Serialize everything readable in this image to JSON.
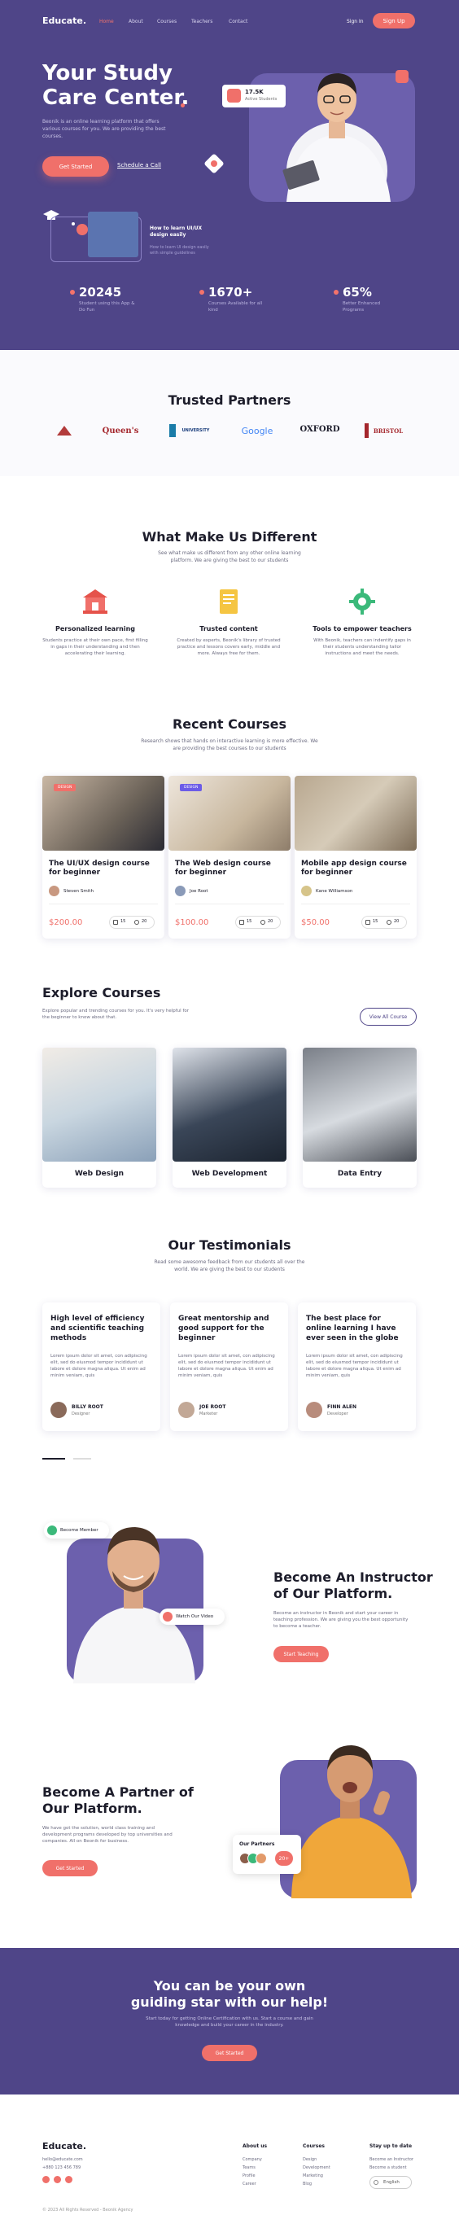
{
  "nav": {
    "logo": "Educate.",
    "links": [
      "Home",
      "About",
      "Courses",
      "Teachers",
      "Contact"
    ],
    "signin": "Sign In",
    "signup": "Sign Up"
  },
  "hero": {
    "title_line1": "Your Study",
    "title_line2": "Care Center.",
    "desc": "Beonik is an online learning platform that offers various courses for you. We are providing the best courses.",
    "cta_primary": "Get Started",
    "cta_secondary": "Schedule a Call",
    "badge_count": "17.5K",
    "badge_label": "Active Students",
    "course_card_title": "How to learn UI/UX design easily",
    "course_card_desc": "How to learn UI design easily with simple guidelines"
  },
  "stats": [
    {
      "value": "20245",
      "label": "Student using this App & Do Fun"
    },
    {
      "value": "1670+",
      "label": "Courses Available for all kind"
    },
    {
      "value": "65%",
      "label": "Better Enhanced Programs"
    }
  ],
  "partners": {
    "title": "Trusted Partners",
    "logos": [
      "Queen's",
      "UNIVERSITY",
      "Google",
      "OXFORD",
      "BRISTOL"
    ]
  },
  "different": {
    "title": "What Make Us Different",
    "subtitle": "See what make us different from any other online learning platform. We are giving the best to our students",
    "features": [
      {
        "title": "Personalized learning",
        "desc": "Students practice at their own pace, first filling in gaps in their understanding and then accelerating their learning."
      },
      {
        "title": "Trusted content",
        "desc": "Created by experts, Beonik's library of trusted practice and lessons covers early, middle and more. Always free for them."
      },
      {
        "title": "Tools to empower teachers",
        "desc": "With Beonik, teachers can indentify gaps in their students understanding tailor instructions and meet the needs."
      }
    ]
  },
  "courses": {
    "title": "Recent Courses",
    "subtitle": "Research shows that hands on interactive learning is more effective. We are providing the best courses to our students",
    "items": [
      {
        "tag": "DESIGN",
        "title": "The UI/UX design course for beginner",
        "author": "Steven Smith",
        "price": "$200.00",
        "lessons": "15",
        "students": "20"
      },
      {
        "tag": "DESIGN",
        "title": "The Web design course for beginner",
        "author": "Joe Root",
        "price": "$100.00",
        "lessons": "15",
        "students": "20"
      },
      {
        "tag": "",
        "title": "Mobile app design course for beginner",
        "author": "Kane Williamson",
        "price": "$50.00",
        "lessons": "15",
        "students": "20"
      }
    ]
  },
  "explore": {
    "title": "Explore Courses",
    "desc": "Explore popular and trending courses for you. It's very helpful for the beginner to know about that.",
    "button": "View All Course",
    "items": [
      "Web Design",
      "Web Development",
      "Data Entry"
    ]
  },
  "testimonials": {
    "title": "Our Testimonials",
    "subtitle": "Read some awesome feedback from our students all over the world. We are giving the best to our students",
    "items": [
      {
        "title": "High level of efficiency and scientific teaching methods",
        "body": "Lorem ipsum dolor sit amet, con adipiscing elit, sed do eiusmod tempor incididunt ut labore et dolore magna aliqua. Ut enim ad minim veniam, quis",
        "name": "BILLY ROOT",
        "role": "Designer"
      },
      {
        "title": "Great mentorship and good support for the beginner",
        "body": "Lorem ipsum dolor sit amet, con adipiscing elit, sed do eiusmod tempor incididunt ut labore et dolore magna aliqua. Ut enim ad minim veniam, quis",
        "name": "JOE ROOT",
        "role": "Marketer"
      },
      {
        "title": "The best place for online learning I have ever seen in the globe",
        "body": "Lorem ipsum dolor sit amet, con adipiscing elit, sed do eiusmod tempor incididunt ut labore et dolore magna aliqua. Ut enim ad minim veniam, quis",
        "name": "FINN ALEN",
        "role": "Developer"
      }
    ]
  },
  "instructor": {
    "badge": "Become Member",
    "video": "Watch Our Video",
    "title_line1": "Become An Instructor",
    "title_line2": "of Our Platform.",
    "desc": "Become an instructor in Beonik and start your career in teaching profession. We are giving you the best opportunity to become a teacher.",
    "button": "Start Teaching"
  },
  "partner_cta": {
    "title_line1": "Become A Partner of",
    "title_line2": "Our Platform.",
    "desc": "We have got the solution, world class training and development programs developed by top universities and companies. All on Beonik for business.",
    "button": "Get Started",
    "card_label": "Our Partners",
    "card_badge": "20+"
  },
  "cta": {
    "line1": "You can be your own",
    "line2": "guiding star with our help!",
    "desc": "Start today for getting Online Certification with us. Start a course and gain knowledge and build your career in the industry.",
    "button": "Get Started"
  },
  "footer": {
    "logo": "Educate.",
    "email": "hello@educate.com",
    "phone": "+880 123 456 789",
    "about_title": "About us",
    "about": [
      "Company",
      "Teams",
      "Profile",
      "Career"
    ],
    "courses_title": "Courses",
    "courses": [
      "Design",
      "Development",
      "Marketing",
      "Blog"
    ],
    "update_title": "Stay up to date",
    "update": [
      "Become an Instructor",
      "Become a student"
    ],
    "language": "English",
    "copyright": "© 2023 All Rights Reserved - Beonik Agency"
  },
  "colors": {
    "primary": "#4f4588",
    "accent": "#f0706a"
  }
}
